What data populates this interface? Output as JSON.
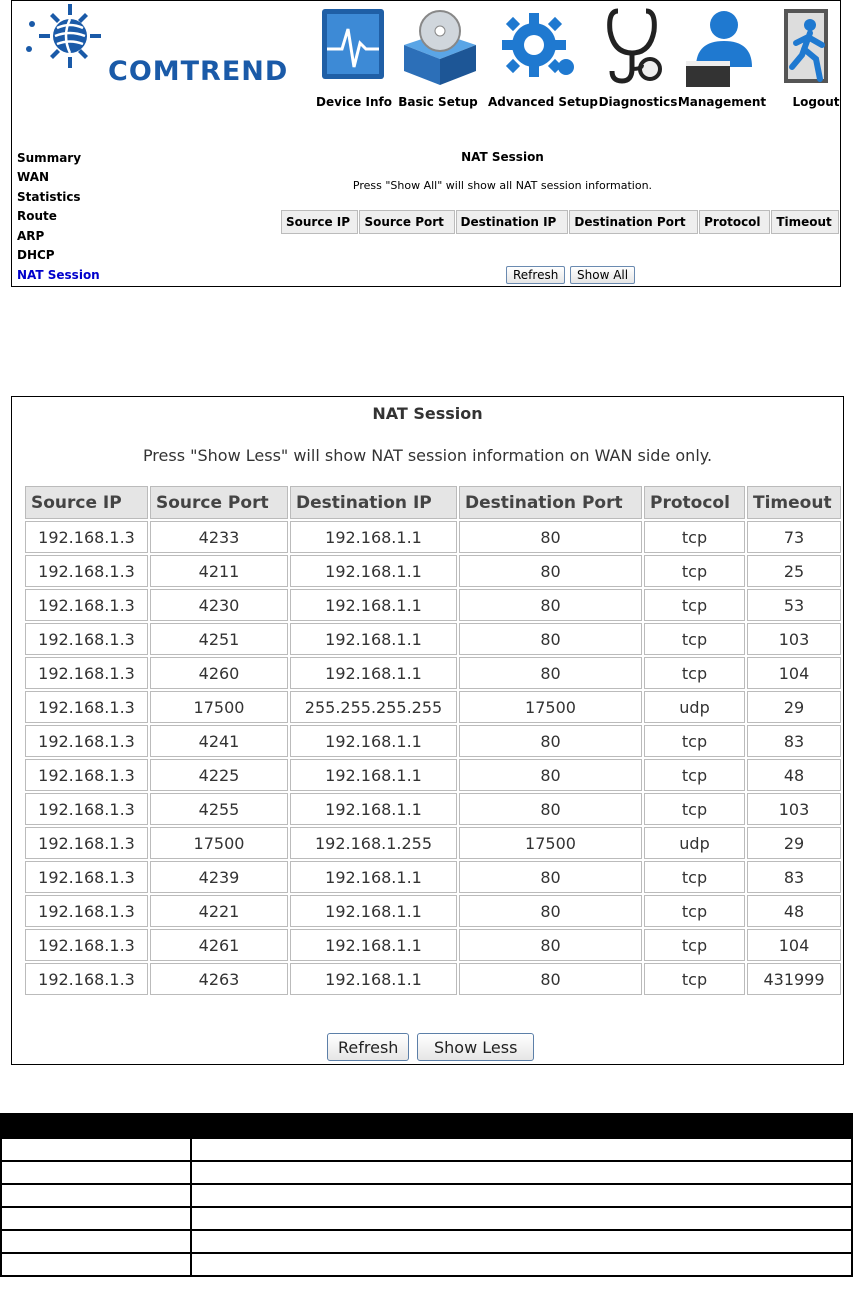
{
  "brand": {
    "name": "COMTREND",
    "color": "#1a5aa8"
  },
  "nav": [
    {
      "label": "Device Info",
      "icon": "monitor-pulse-icon"
    },
    {
      "label": "Basic Setup",
      "icon": "box-cd-icon"
    },
    {
      "label": "Advanced Setup",
      "icon": "gear-icon"
    },
    {
      "label": "Diagnostics",
      "icon": "stethoscope-icon"
    },
    {
      "label": "Management",
      "icon": "user-laptop-icon"
    },
    {
      "label": "Logout",
      "icon": "exit-door-icon"
    }
  ],
  "sidebar": {
    "items": [
      "Summary",
      "WAN",
      "Statistics",
      "Route",
      "ARP",
      "DHCP",
      "NAT Session"
    ],
    "active_index": 6,
    "active_color": "#0000cc"
  },
  "panel1": {
    "title": "NAT Session",
    "description": "Press \"Show All\" will show all NAT session information.",
    "columns": [
      "Source IP",
      "Source Port",
      "Destination IP",
      "Destination Port",
      "Protocol",
      "Timeout"
    ],
    "refresh_label": "Refresh",
    "show_all_label": "Show All"
  },
  "panel2": {
    "title": "NAT Session",
    "description": "Press \"Show Less\" will show NAT session information on WAN side only.",
    "columns": [
      "Source IP",
      "Source Port",
      "Destination IP",
      "Destination Port",
      "Protocol",
      "Timeout"
    ],
    "rows": [
      [
        "192.168.1.3",
        "4233",
        "192.168.1.1",
        "80",
        "tcp",
        "73"
      ],
      [
        "192.168.1.3",
        "4211",
        "192.168.1.1",
        "80",
        "tcp",
        "25"
      ],
      [
        "192.168.1.3",
        "4230",
        "192.168.1.1",
        "80",
        "tcp",
        "53"
      ],
      [
        "192.168.1.3",
        "4251",
        "192.168.1.1",
        "80",
        "tcp",
        "103"
      ],
      [
        "192.168.1.3",
        "4260",
        "192.168.1.1",
        "80",
        "tcp",
        "104"
      ],
      [
        "192.168.1.3",
        "17500",
        "255.255.255.255",
        "17500",
        "udp",
        "29"
      ],
      [
        "192.168.1.3",
        "4241",
        "192.168.1.1",
        "80",
        "tcp",
        "83"
      ],
      [
        "192.168.1.3",
        "4225",
        "192.168.1.1",
        "80",
        "tcp",
        "48"
      ],
      [
        "192.168.1.3",
        "4255",
        "192.168.1.1",
        "80",
        "tcp",
        "103"
      ],
      [
        "192.168.1.3",
        "17500",
        "192.168.1.255",
        "17500",
        "udp",
        "29"
      ],
      [
        "192.168.1.3",
        "4239",
        "192.168.1.1",
        "80",
        "tcp",
        "83"
      ],
      [
        "192.168.1.3",
        "4221",
        "192.168.1.1",
        "80",
        "tcp",
        "48"
      ],
      [
        "192.168.1.3",
        "4261",
        "192.168.1.1",
        "80",
        "tcp",
        "104"
      ],
      [
        "192.168.1.3",
        "4263",
        "192.168.1.1",
        "80",
        "tcp",
        "431999"
      ]
    ],
    "refresh_label": "Refresh",
    "show_less_label": "Show Less"
  },
  "doc_table": {
    "row_count": 7,
    "header_color": "#000000"
  }
}
